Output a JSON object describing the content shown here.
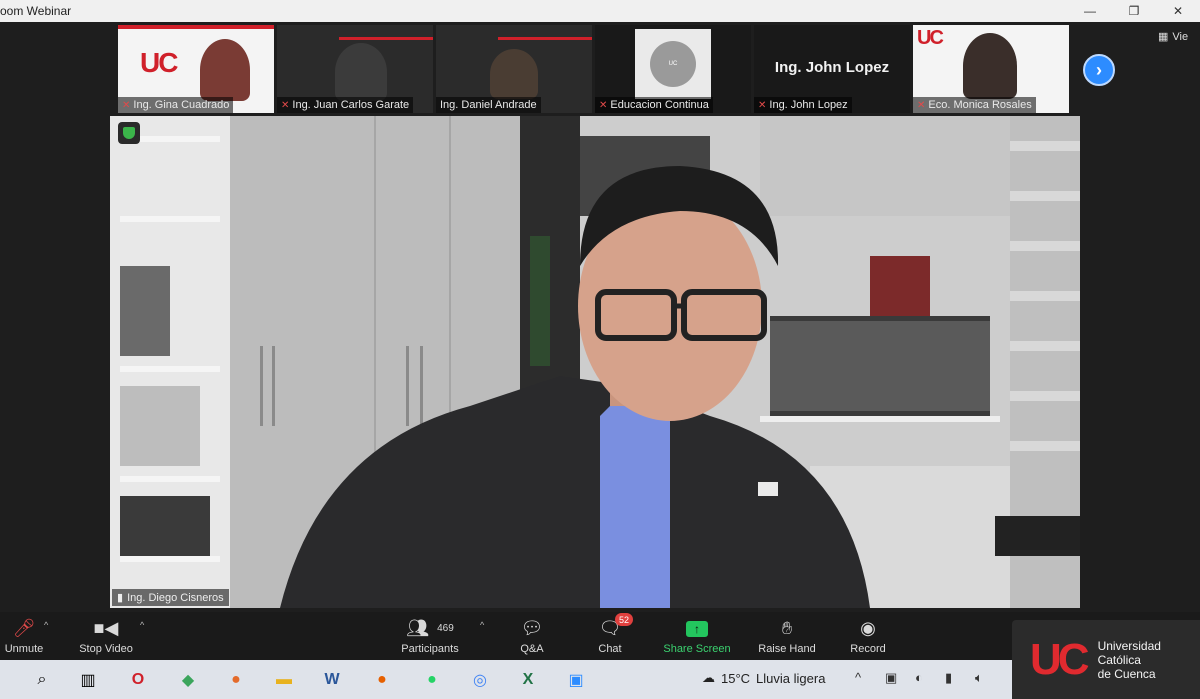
{
  "window": {
    "title": "oom Webinar",
    "controls": [
      "—",
      "❐",
      "✕"
    ]
  },
  "thumbnails": [
    {
      "name": "Ing. Gina Cuadrado"
    },
    {
      "name": "Ing. Juan Carlos Garate"
    },
    {
      "name": "Ing. Daniel Andrade"
    },
    {
      "name": "Educacion Continua"
    },
    {
      "name": "Ing. John Lopez",
      "heading": "Ing. John Lopez"
    },
    {
      "name": "Eco. Monica Rosales"
    }
  ],
  "view_button": {
    "label": "Vie"
  },
  "speaker": {
    "name": "Ing. Diego Cisneros"
  },
  "toolbar": {
    "unmute": "Unmute",
    "stop_video": "Stop Video",
    "participants": "Participants",
    "participants_count": "469",
    "qa": "Q&A",
    "chat": "Chat",
    "chat_badge": "52",
    "share_screen": "Share Screen",
    "raise_hand": "Raise Hand",
    "record": "Record"
  },
  "brand": {
    "logo_text": "UC",
    "line1": "Universidad",
    "line2": "Católica",
    "line3": "de Cuenca"
  },
  "taskbar": {
    "weather_temp": "15°C",
    "weather_desc": "Lluvia ligera"
  },
  "colors": {
    "accent_blue": "#2d8cff",
    "share_green": "#23c55e",
    "brand_red": "#e02a2f"
  }
}
